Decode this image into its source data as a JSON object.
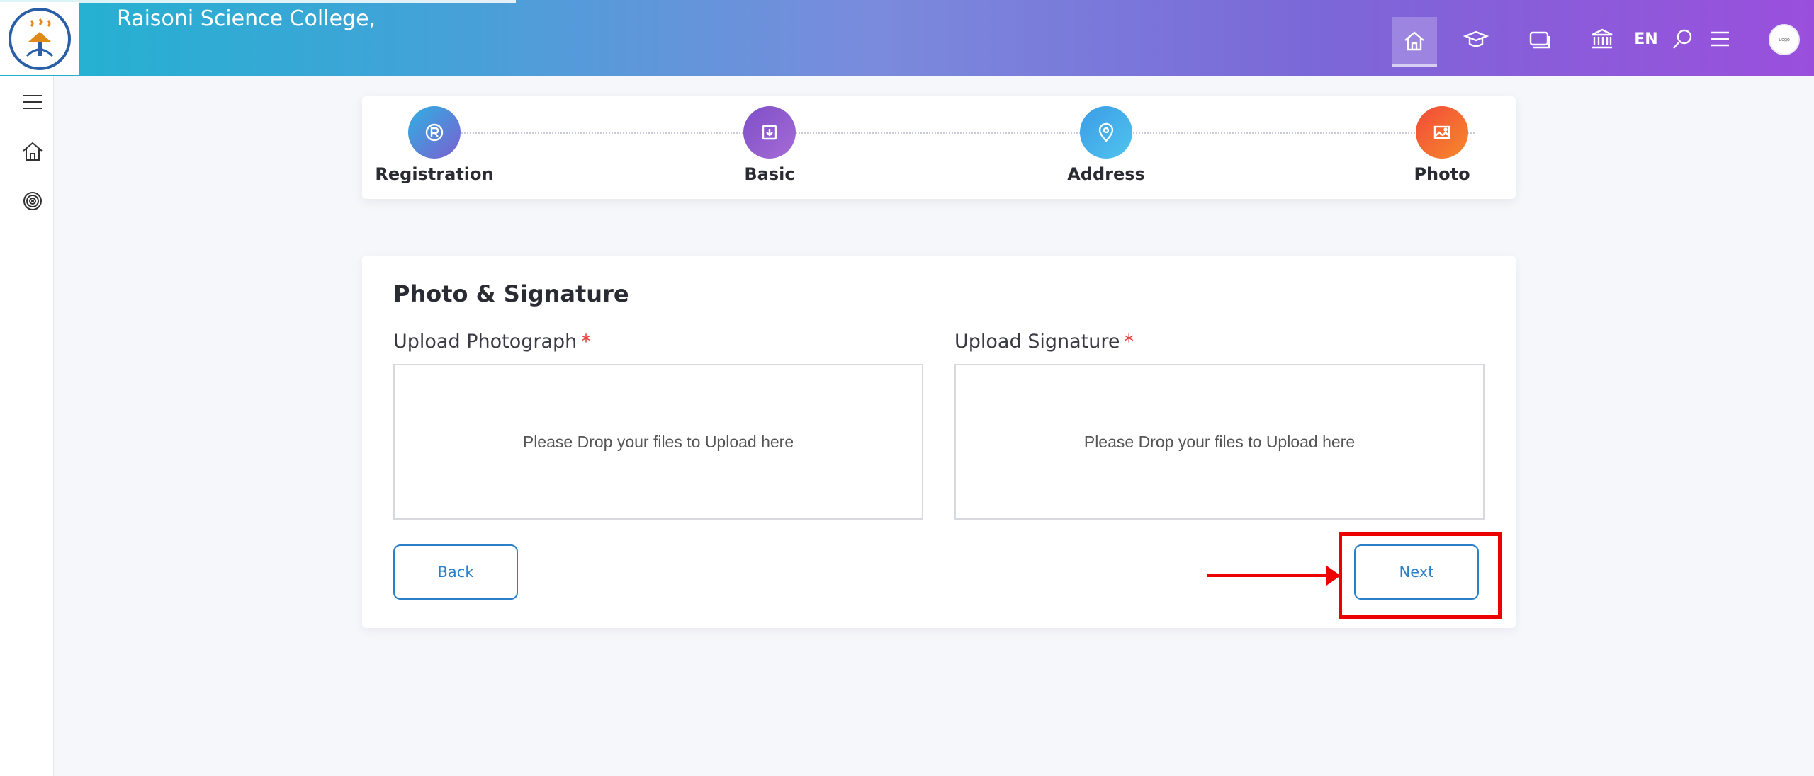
{
  "header": {
    "college_name": "Raisoni Science College,",
    "language": "EN",
    "avatar_text": "Logo",
    "icons": [
      "home-icon",
      "graduation-cap-icon",
      "cards-icon",
      "institution-icon",
      "search-icon",
      "menu-icon"
    ]
  },
  "sidebar": {
    "items": [
      {
        "icon": "menu-icon"
      },
      {
        "icon": "home-icon"
      },
      {
        "icon": "target-icon"
      }
    ]
  },
  "stepper": {
    "steps": [
      {
        "label": "Registration",
        "icon": "registered-icon",
        "color": "#3aa0e0"
      },
      {
        "label": "Basic",
        "icon": "download-box-icon",
        "color": "#8e55c8"
      },
      {
        "label": "Address",
        "icon": "location-pin-icon",
        "color": "#3eb2e8"
      },
      {
        "label": "Photo",
        "icon": "image-icon",
        "color": "#f25d2f"
      }
    ]
  },
  "form": {
    "title": "Photo & Signature",
    "photo_label": "Upload Photograph",
    "signature_label": "Upload Signature",
    "required_mark": "*",
    "photo_dropzone_text": "Please Drop your files to Upload here",
    "signature_dropzone_text": "Please Drop your files to Upload here",
    "back_label": "Back",
    "next_label": "Next"
  },
  "colors": {
    "accent": "#2b7fc8",
    "required": "#e53935",
    "annotation": "#ec0000"
  }
}
